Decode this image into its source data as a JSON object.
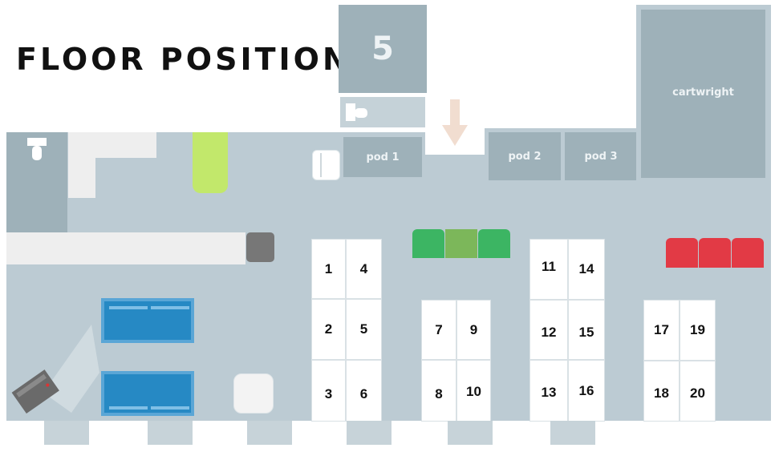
{
  "title": "FLOOR POSITIONS",
  "rooms": {
    "room5": "5",
    "pod1": "pod 1",
    "pod2": "pod 2",
    "pod3": "pod 3",
    "cartwright": "cartwright"
  },
  "desks": [
    "1",
    "2",
    "3",
    "4",
    "5",
    "6",
    "7",
    "8",
    "9",
    "10",
    "11",
    "12",
    "13",
    "14",
    "15",
    "16",
    "17",
    "18",
    "19",
    "20"
  ],
  "colors": {
    "floor": "#bccbd3",
    "room": "#9eb1b9",
    "green_seats": "#3cb563",
    "red_seats": "#e23a45",
    "blue_tables": "#2689c4",
    "lime_bar": "#c2e86b",
    "entrance_arrow": "#f1ddd0"
  },
  "icons": [
    "restroom-icon",
    "entrance-arrow-icon",
    "printer-icon",
    "trash-bin-icon"
  ]
}
